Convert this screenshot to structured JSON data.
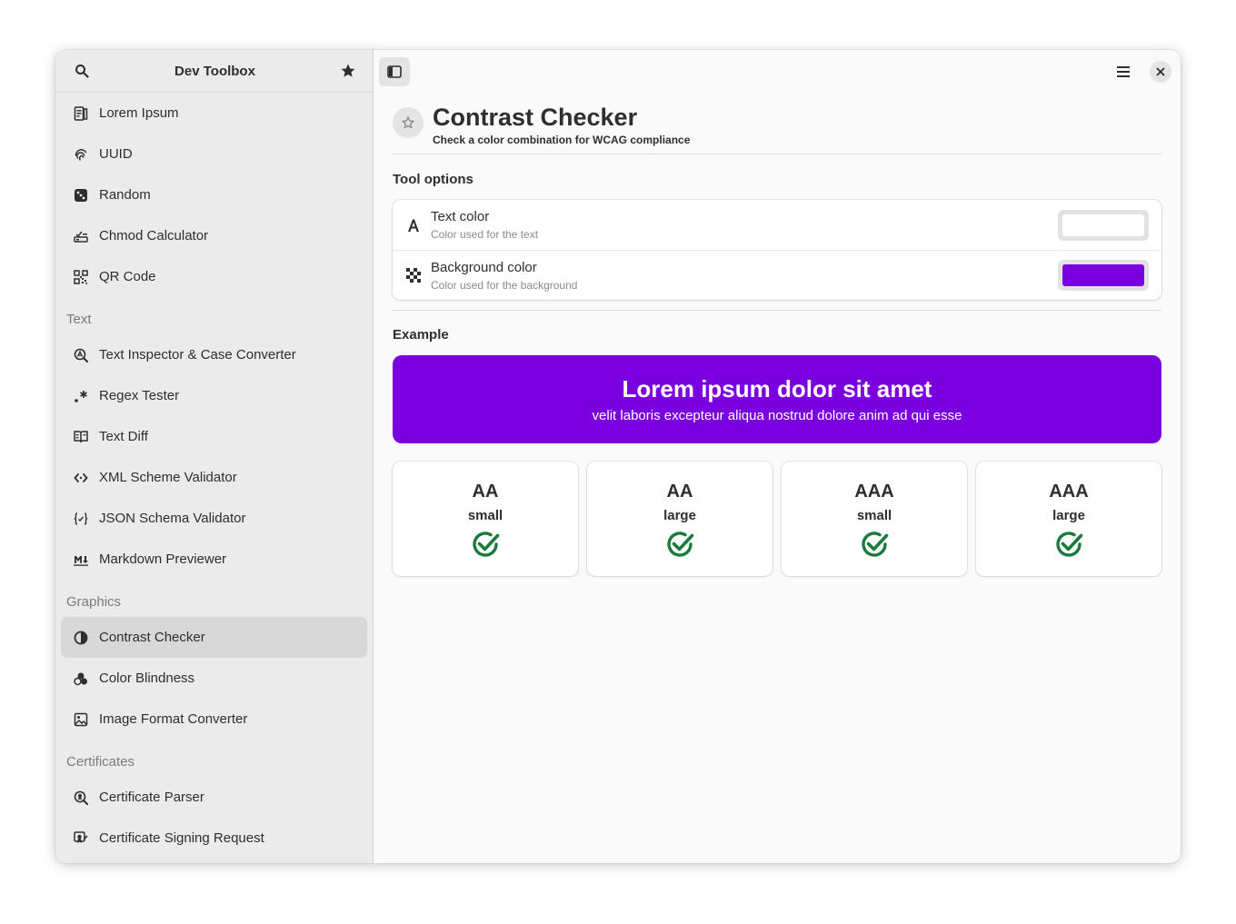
{
  "app": {
    "title": "Dev Toolbox"
  },
  "sidebar": {
    "groups": [
      {
        "label": "",
        "items": [
          {
            "label": "Lorem Ipsum",
            "icon": "document-text-icon"
          },
          {
            "label": "UUID",
            "icon": "fingerprint-icon"
          },
          {
            "label": "Random",
            "icon": "dice-icon"
          },
          {
            "label": "Chmod Calculator",
            "icon": "permissions-icon"
          },
          {
            "label": "QR Code",
            "icon": "qr-code-icon"
          }
        ]
      },
      {
        "label": "Text",
        "items": [
          {
            "label": "Text Inspector & Case Converter",
            "icon": "text-search-icon"
          },
          {
            "label": "Regex Tester",
            "icon": "regex-icon"
          },
          {
            "label": "Text Diff",
            "icon": "book-diff-icon"
          },
          {
            "label": "XML Scheme Validator",
            "icon": "code-brackets-icon"
          },
          {
            "label": "JSON Schema Validator",
            "icon": "json-braces-icon"
          },
          {
            "label": "Markdown Previewer",
            "icon": "markdown-icon"
          }
        ]
      },
      {
        "label": "Graphics",
        "items": [
          {
            "label": "Contrast Checker",
            "icon": "contrast-icon",
            "active": true
          },
          {
            "label": "Color Blindness",
            "icon": "color-circles-icon"
          },
          {
            "label": "Image Format Converter",
            "icon": "image-icon"
          }
        ]
      },
      {
        "label": "Certificates",
        "items": [
          {
            "label": "Certificate Parser",
            "icon": "certificate-search-icon"
          },
          {
            "label": "Certificate Signing Request",
            "icon": "certificate-sign-icon"
          }
        ]
      }
    ]
  },
  "tool": {
    "title": "Contrast Checker",
    "subtitle": "Check a color combination for WCAG compliance",
    "options_label": "Tool options",
    "options": [
      {
        "title": "Text color",
        "subtitle": "Color used for the text",
        "icon": "letter-a-icon",
        "color": "#ffffff"
      },
      {
        "title": "Background color",
        "subtitle": "Color used for the background",
        "icon": "checkerboard-icon",
        "color": "#7b00e0"
      }
    ],
    "example_label": "Example",
    "example": {
      "title": "Lorem ipsum dolor sit amet",
      "subtitle": "velit laboris excepteur aliqua nostrud dolore anim ad qui esse",
      "text_color": "#ffffff",
      "background_color": "#7b00e0"
    },
    "results": [
      {
        "level": "AA",
        "size": "small",
        "pass": true
      },
      {
        "level": "AA",
        "size": "large",
        "pass": true
      },
      {
        "level": "AAA",
        "size": "small",
        "pass": true
      },
      {
        "level": "AAA",
        "size": "large",
        "pass": true
      }
    ],
    "pass_color": "#1a7a3c"
  }
}
